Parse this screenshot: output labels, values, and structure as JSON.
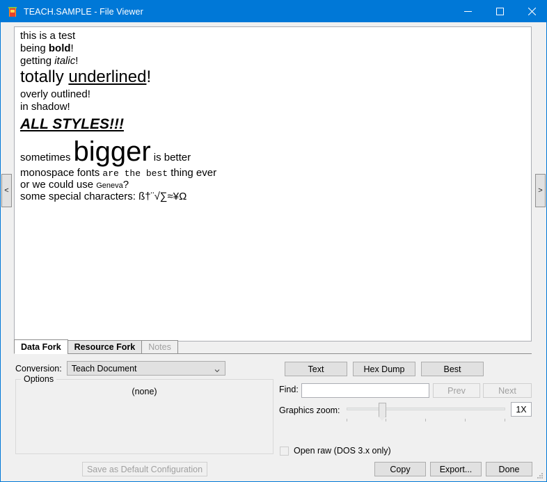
{
  "window": {
    "title": "TEACH.SAMPLE - File Viewer",
    "icon": "app-icon",
    "accent_color": "#0078d7",
    "controls": {
      "minimize": "minimize-icon",
      "maximize": "maximize-icon",
      "close": "close-icon"
    }
  },
  "navigation": {
    "prev_arrow": "<",
    "next_arrow": ">"
  },
  "document": {
    "lines": {
      "l1": "this is a test",
      "l2_prefix": "being ",
      "l2_bold": "bold",
      "l2_suffix": "!",
      "l3_prefix": "getting ",
      "l3_italic": "italic",
      "l3_suffix": "!",
      "l4_prefix": "totally ",
      "l4_underline": "underlined",
      "l4_suffix": "!",
      "l5": "overly outlined!",
      "l6": "in shadow!",
      "l7": "ALL STYLES!!!",
      "l8_prefix": "sometimes",
      "l8_big": "bigger",
      "l8_suffix": "is better",
      "l9_prefix": "monospace fonts ",
      "l9_mono": "are the best",
      "l9_suffix": " thing ever",
      "l10_prefix": "or we could use ",
      "l10_geneva": "Geneva",
      "l10_suffix": "?",
      "l11": "some special characters: ß†¨√∑≈¥Ω"
    }
  },
  "tabs": [
    {
      "label": "Data Fork",
      "state": "active"
    },
    {
      "label": "Resource Fork",
      "state": "inactive"
    },
    {
      "label": "Notes",
      "state": "disabled"
    }
  ],
  "conversion": {
    "label": "Conversion:",
    "value": "Teach Document",
    "chevron": "chevron-down-icon"
  },
  "options": {
    "legend": "Options",
    "content": "(none)"
  },
  "view_buttons": {
    "text": "Text",
    "hex_dump": "Hex Dump",
    "best": "Best"
  },
  "find": {
    "label": "Find:",
    "value": "",
    "placeholder": "",
    "prev": "Prev",
    "next": "Next"
  },
  "graphics_zoom": {
    "label": "Graphics zoom:",
    "value": "1X",
    "tick_count": 5,
    "thumb_position_percent": 21
  },
  "open_raw": {
    "label": "Open raw (DOS 3.x only)",
    "checked": false
  },
  "footer": {
    "save_default": "Save as Default Configuration",
    "copy": "Copy",
    "export": "Export...",
    "done": "Done"
  }
}
